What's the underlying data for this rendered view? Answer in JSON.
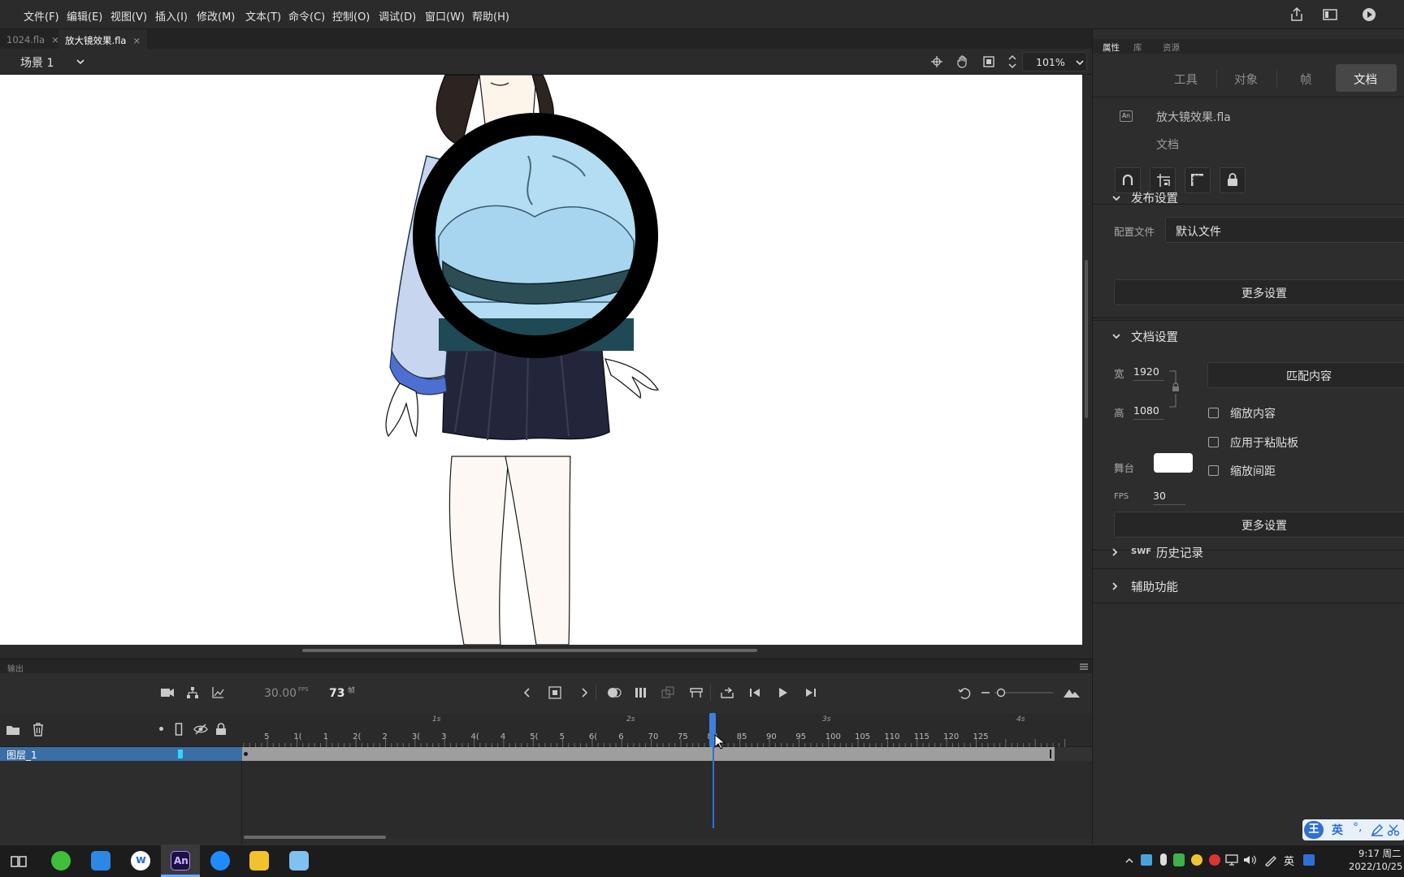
{
  "menu": {
    "items": [
      "文件(F)",
      "编辑(E)",
      "视图(V)",
      "插入(I)",
      "修改(M)",
      "文本(T)",
      "命令(C)",
      "控制(O)",
      "调试(D)",
      "窗口(W)",
      "帮助(H)"
    ],
    "icons": [
      "share-icon",
      "workspace-icon",
      "play-circle-icon"
    ]
  },
  "tabs": [
    {
      "label": "1024.fla",
      "active": false
    },
    {
      "label": "放大镜效果.fla",
      "active": true
    }
  ],
  "scene": {
    "label": "场景 1",
    "zoom": "101%"
  },
  "output": {
    "label": "输出"
  },
  "timeline": {
    "fps": "30.00",
    "fps_unit": "FPS",
    "frame": "73",
    "frame_unit": "帧",
    "layer_name": "图层_1",
    "current_frame": 73,
    "total_frames": 125,
    "ruler_labels": [
      "5",
      "1(",
      "1",
      "2(",
      "2",
      "3(",
      "3",
      "4(",
      "4",
      "5(",
      "5",
      "6(",
      "6",
      "70",
      "75",
      "80",
      "85",
      "90",
      "95",
      "100",
      "105",
      "110",
      "115",
      "120",
      "125"
    ],
    "second_markers": [
      "1s",
      "2s",
      "3s",
      "4s"
    ]
  },
  "panel": {
    "tabs": [
      "属性",
      "库",
      "资源"
    ],
    "segments": [
      "工具",
      "对象",
      "帧",
      "文档"
    ],
    "active_segment": "文档",
    "doc_name": "放大镜效果.fla",
    "doc_type": "文档",
    "publish": {
      "title": "发布设置",
      "profile_label": "配置文件",
      "profile_value": "默认文件",
      "more_button": "更多设置"
    },
    "doc_settings": {
      "title": "文档设置",
      "width_label": "宽",
      "width_value": "1920",
      "height_label": "高",
      "height_value": "1080",
      "match_button": "匹配内容",
      "scale_content": "缩放内容",
      "apply_pasteboard": "应用于粘贴板",
      "scale_spacing": "缩放间距",
      "stage_label": "舞台",
      "stage_color": "#ffffff",
      "fps_label": "FPS",
      "fps_value": "30",
      "more_button": "更多设置"
    },
    "swf_history": {
      "prefix": "SWF",
      "title": "历史记录"
    },
    "accessibility": {
      "title": "辅助功能"
    }
  },
  "taskbar": {
    "time": "9:17 周二",
    "date": "2022/10/25",
    "ime_lang": "英",
    "ime_badge": "王",
    "ime_badge_lang": "英"
  },
  "colors": {
    "accent": "#3b6ea5",
    "playhead": "#2e6fd8",
    "layer_color_tag": "#2fd5ff"
  }
}
